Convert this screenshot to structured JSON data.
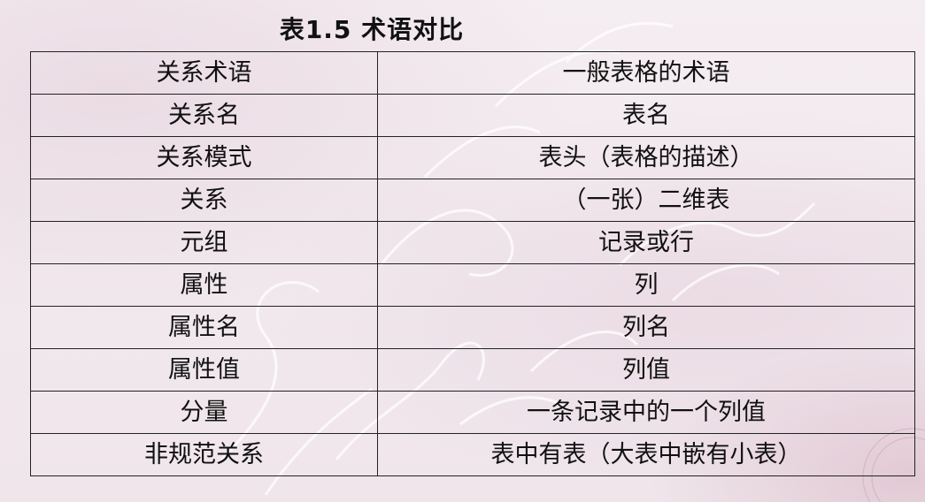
{
  "title": "表1.5  术语对比",
  "table": {
    "headers": [
      "关系术语",
      "一般表格的术语"
    ],
    "rows": [
      [
        "关系名",
        "表名"
      ],
      [
        "关系模式",
        "表头（表格的描述）"
      ],
      [
        "关系",
        "（一张）二维表"
      ],
      [
        "元组",
        "记录或行"
      ],
      [
        "属性",
        "列"
      ],
      [
        "属性名",
        "列名"
      ],
      [
        "属性值",
        "列值"
      ],
      [
        "分量",
        "一条记录中的一个列值"
      ],
      [
        "非规范关系",
        "表中有表（大表中嵌有小表）"
      ]
    ]
  }
}
